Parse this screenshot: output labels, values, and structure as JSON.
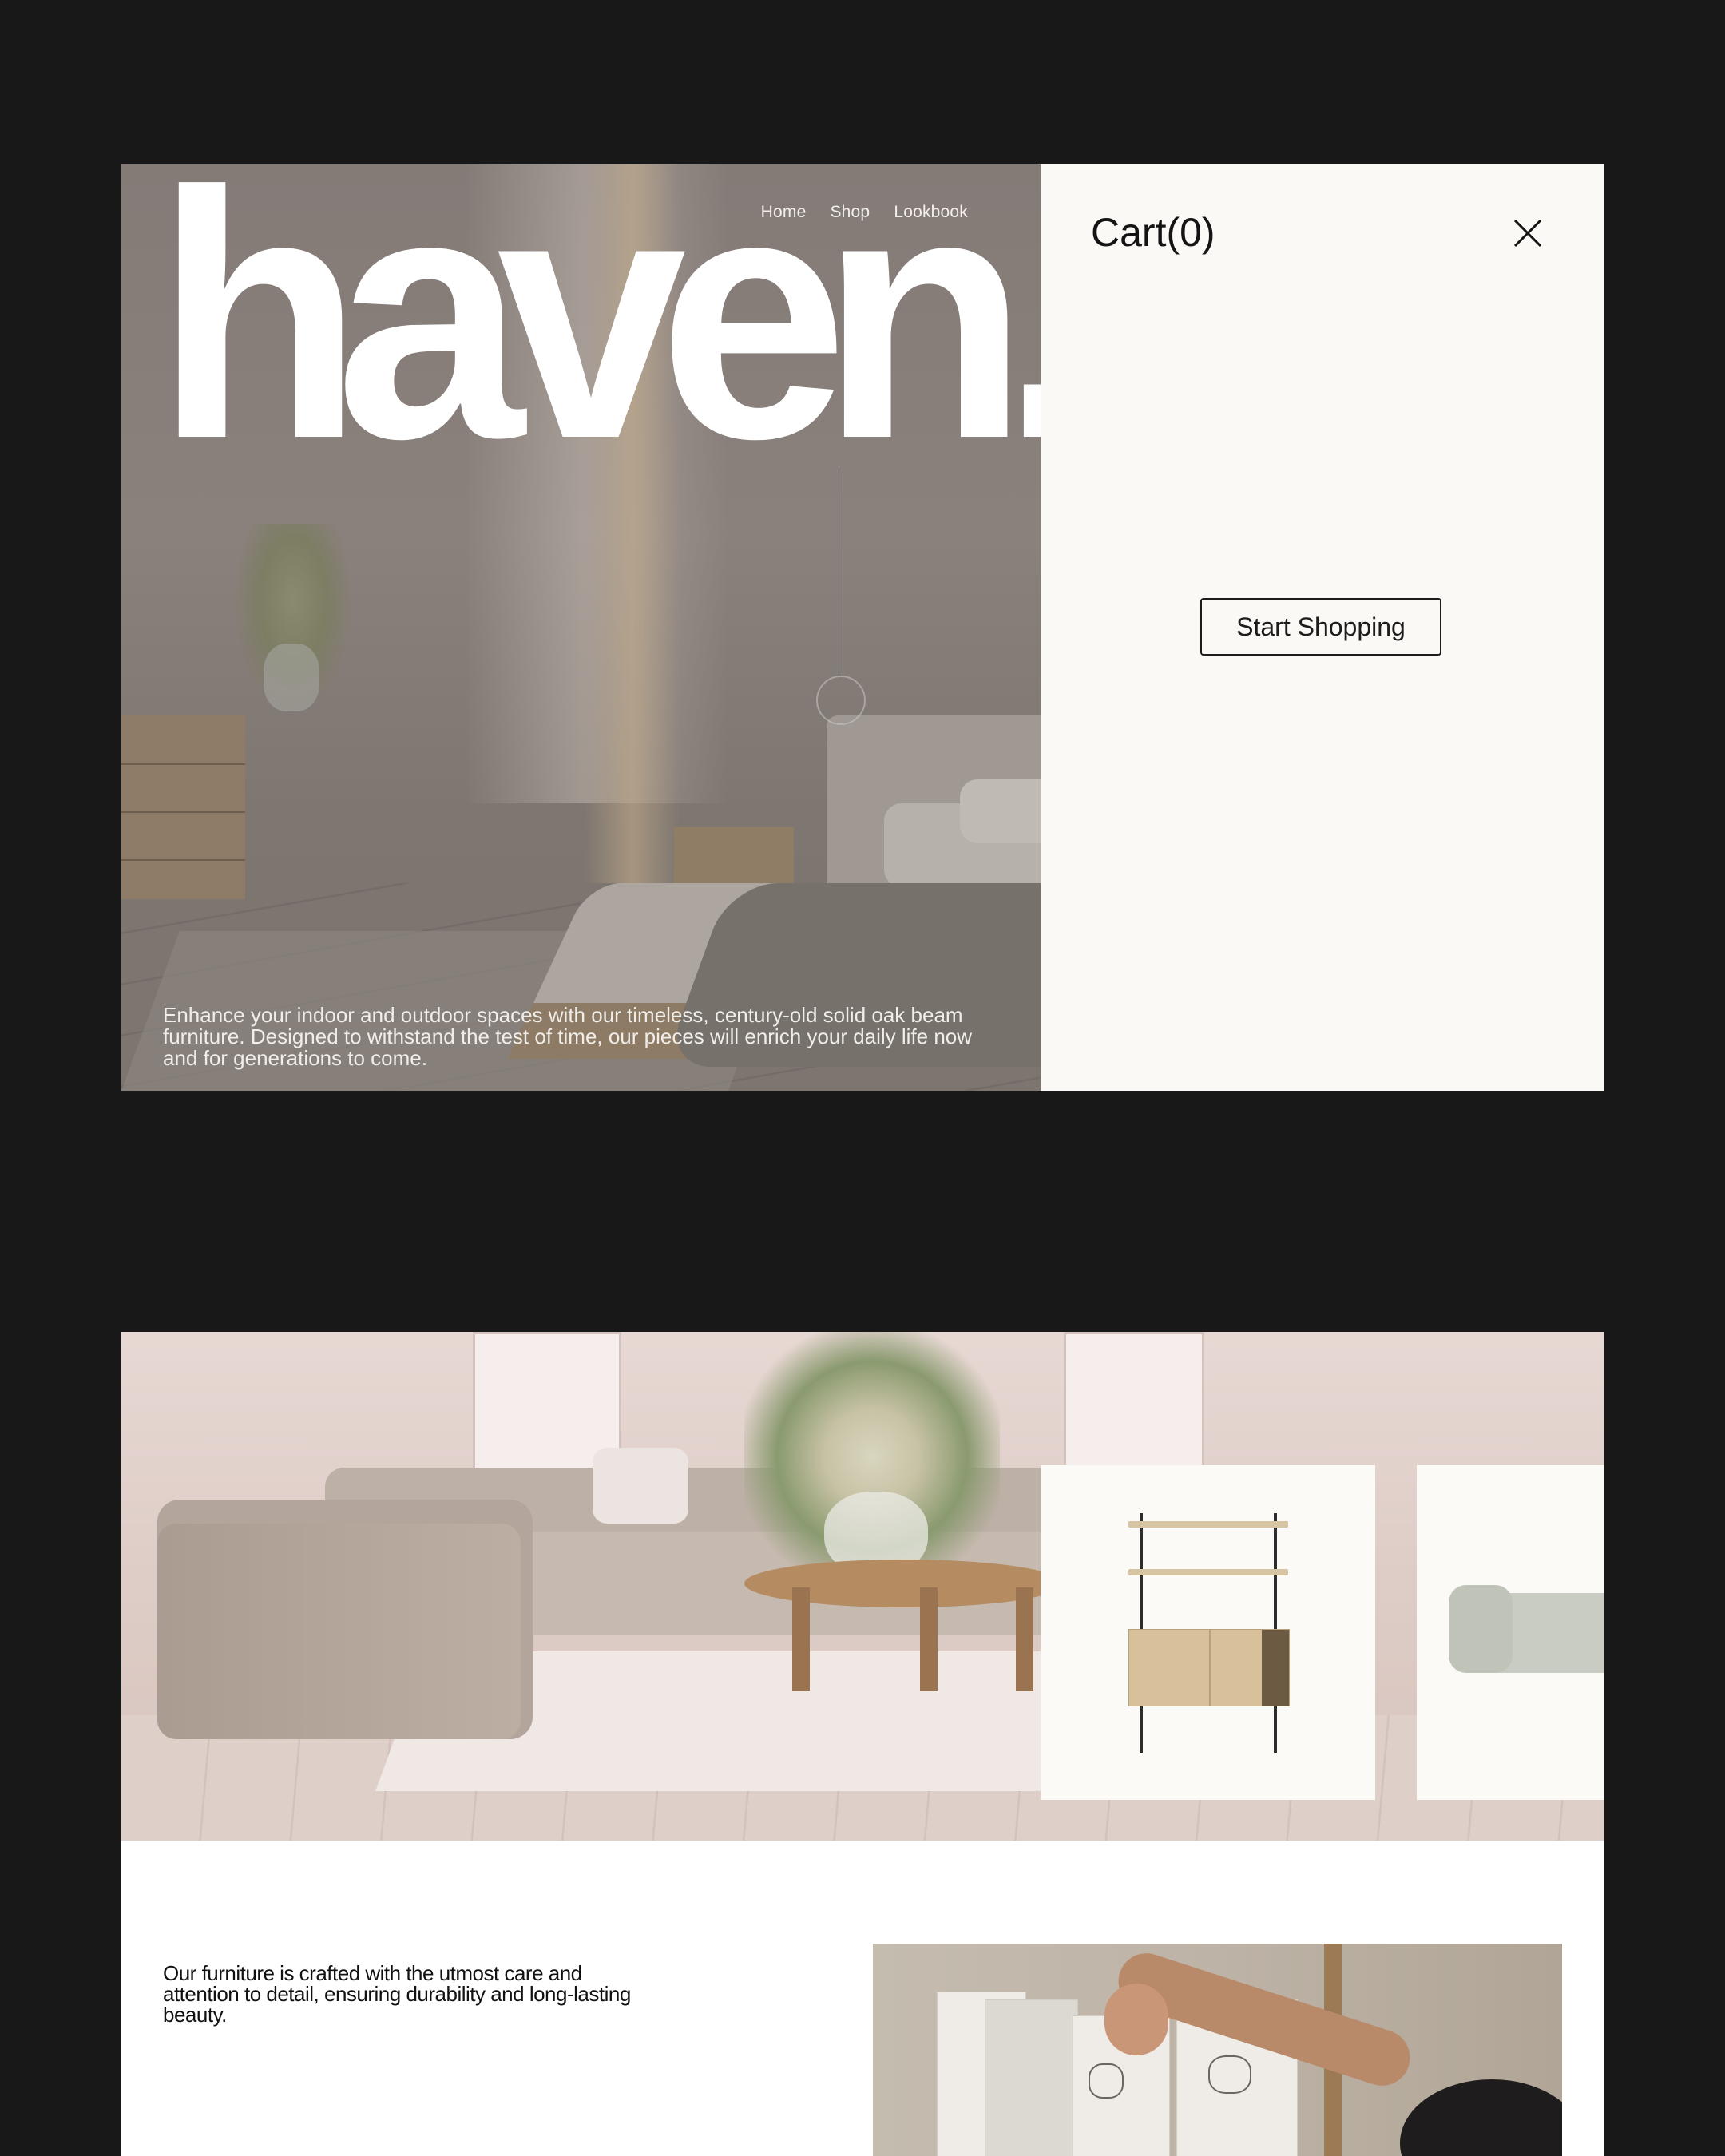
{
  "hero": {
    "nav": [
      "Home",
      "Shop",
      "Lookbook"
    ],
    "logo": "haven.",
    "description": "Enhance your indoor and outdoor spaces with our timeless, century-old solid oak beam furniture. Designed to withstand the test of time, our pieces will enrich your daily life now and for generations to come."
  },
  "cart": {
    "title": "Cart(0)",
    "button": "Start Shopping",
    "close_icon": "close-icon"
  },
  "section2": {
    "craft_text": "Our furniture is crafted with the utmost care and attention to detail, ensuring durability and long-lasting beauty."
  },
  "colors": {
    "page_background": "#181818",
    "cart_background": "#faf9f6",
    "text_dark": "#141414",
    "hero_text": "#ffffff"
  }
}
